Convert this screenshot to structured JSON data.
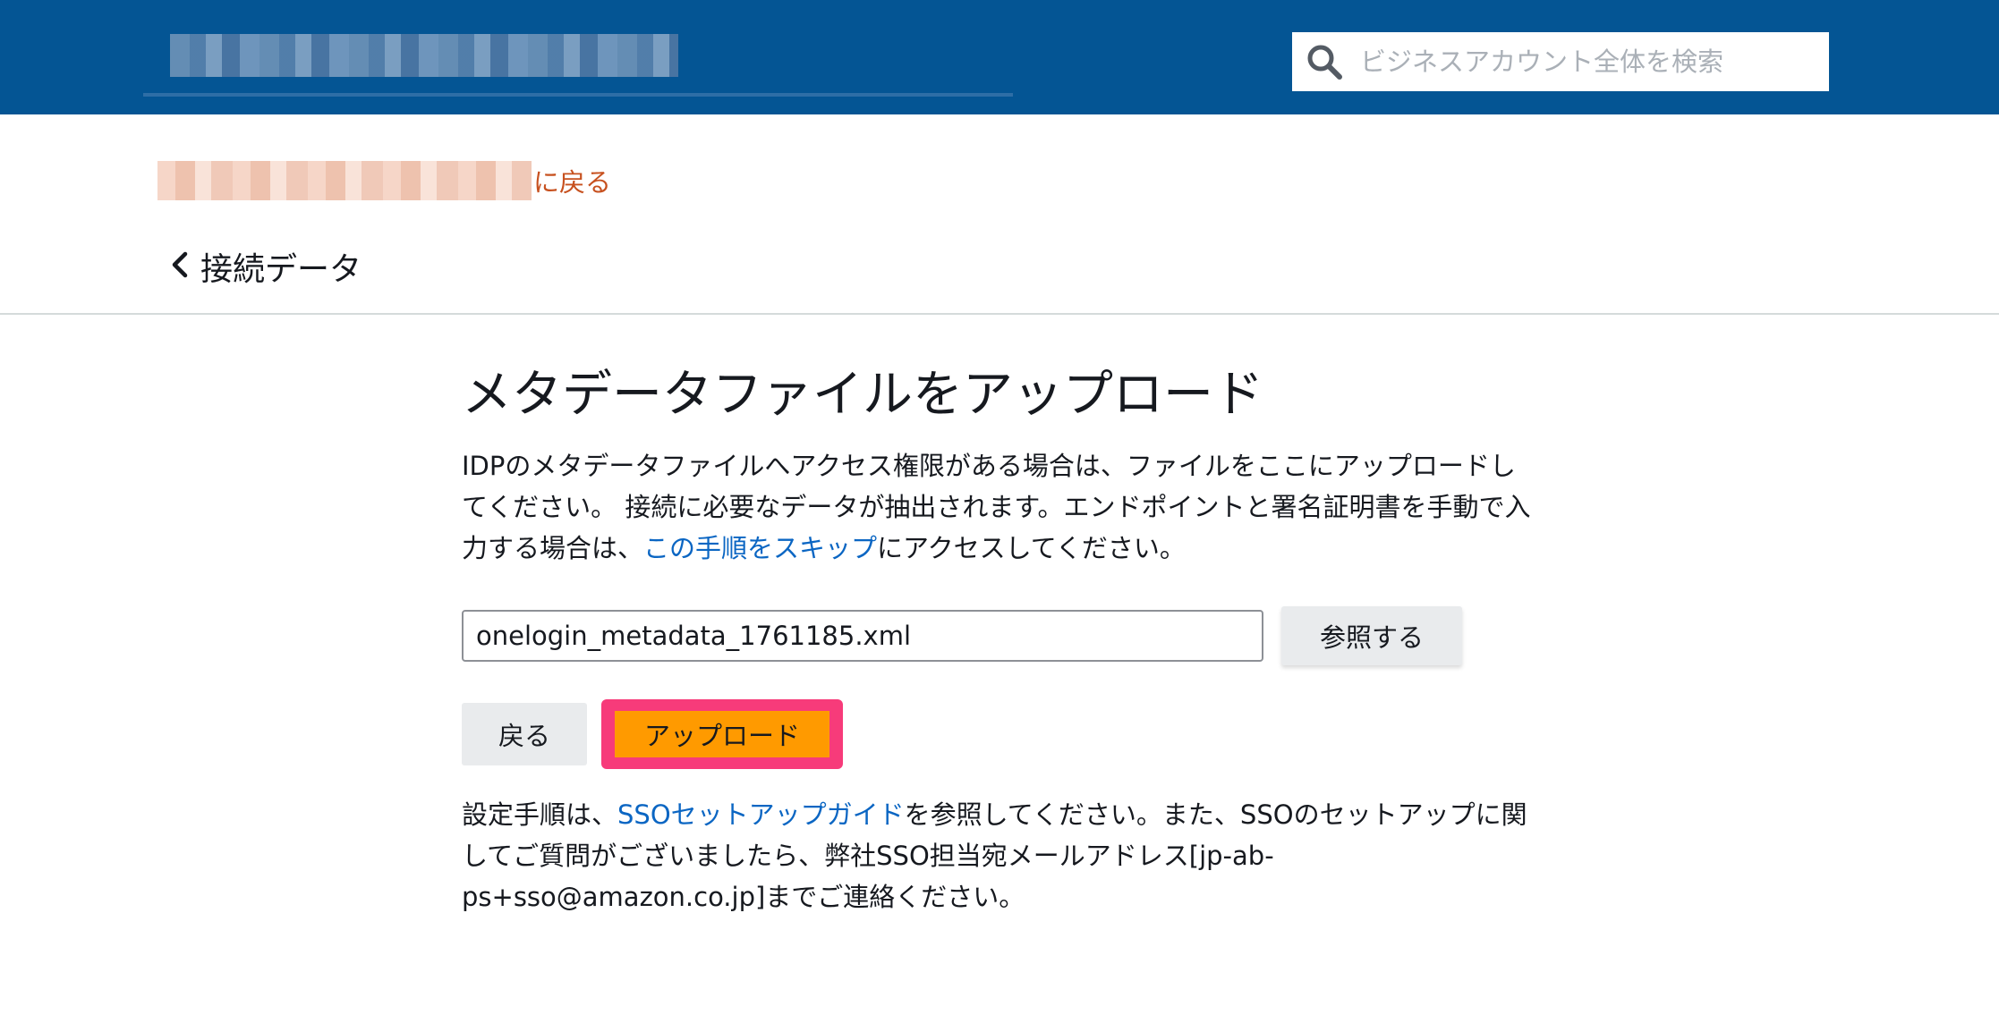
{
  "header": {
    "search_placeholder": "ビジネスアカウント全体を検索"
  },
  "nav": {
    "back_link_suffix": "に戻る",
    "breadcrumb_label": "接続データ"
  },
  "main": {
    "title": "メタデータファイルをアップロード",
    "description_before": "IDPのメタデータファイルへアクセス権限がある場合は、ファイルをここにアップロードしてください。 接続に必要なデータが抽出されます。エンドポイントと署名証明書を手動で入力する場合は、",
    "description_link": "この手順をスキップ",
    "description_after": "にアクセスしてください。",
    "file_value": "onelogin_metadata_1761185.xml",
    "browse_label": "参照する",
    "back_button_label": "戻る",
    "upload_button_label": "アップロード",
    "help_before": "設定手順は、",
    "help_link": "SSOセットアップガイド",
    "help_after": "を参照してください。また、SSOのセットアップに関してご質問がございましたら、弊社SSO担当宛メールアドレス[jp-ab-ps+sso@amazon.co.jp]までご連絡ください。"
  },
  "colors": {
    "header_bg": "#045594",
    "link": "#0b66c3",
    "back_link": "#c7511f",
    "primary_button": "#ff9a00",
    "highlight_border": "#f73b7a"
  }
}
